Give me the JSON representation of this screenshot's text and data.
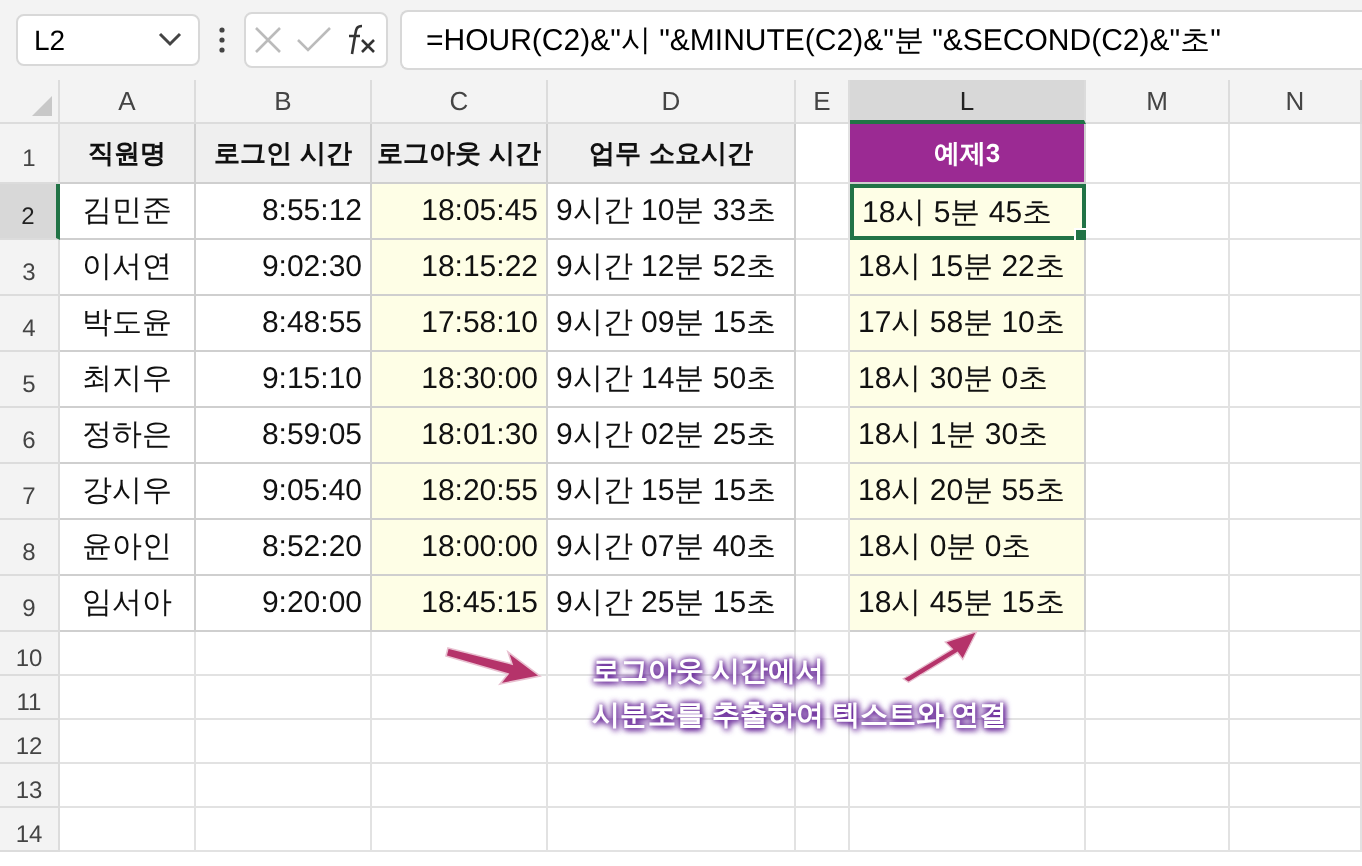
{
  "name_box": {
    "value": "L2"
  },
  "formula_bar": {
    "formula": "=HOUR(C2)&\"시 \"&MINUTE(C2)&\"분 \"&SECOND(C2)&\"초\""
  },
  "columns": [
    {
      "label": "A",
      "selected": false
    },
    {
      "label": "B",
      "selected": false
    },
    {
      "label": "C",
      "selected": false
    },
    {
      "label": "D",
      "selected": false
    },
    {
      "label": "E",
      "selected": false
    },
    {
      "label": "L",
      "selected": true
    },
    {
      "label": "M",
      "selected": false
    },
    {
      "label": "N",
      "selected": false
    }
  ],
  "rows": [
    {
      "number": "1",
      "selected": false,
      "kind": "header",
      "cells": {
        "A": "직원명",
        "B": "로그인 시간",
        "C": "로그아웃 시간",
        "D": "업무 소요시간",
        "L": "예제3"
      }
    },
    {
      "number": "2",
      "selected": true,
      "kind": "data",
      "cells": {
        "A": "김민준",
        "B": "8:55:12",
        "C": "18:05:45",
        "D": "9시간 10분 33초",
        "L": "18시 5분 45초"
      }
    },
    {
      "number": "3",
      "selected": false,
      "kind": "data",
      "cells": {
        "A": "이서연",
        "B": "9:02:30",
        "C": "18:15:22",
        "D": "9시간 12분 52초",
        "L": "18시 15분 22초"
      }
    },
    {
      "number": "4",
      "selected": false,
      "kind": "data",
      "cells": {
        "A": "박도윤",
        "B": "8:48:55",
        "C": "17:58:10",
        "D": "9시간 09분 15초",
        "L": "17시 58분 10초"
      }
    },
    {
      "number": "5",
      "selected": false,
      "kind": "data",
      "cells": {
        "A": "최지우",
        "B": "9:15:10",
        "C": "18:30:00",
        "D": "9시간 14분 50초",
        "L": "18시 30분 0초"
      }
    },
    {
      "number": "6",
      "selected": false,
      "kind": "data",
      "cells": {
        "A": "정하은",
        "B": "8:59:05",
        "C": "18:01:30",
        "D": "9시간 02분 25초",
        "L": "18시 1분 30초"
      }
    },
    {
      "number": "7",
      "selected": false,
      "kind": "data",
      "cells": {
        "A": "강시우",
        "B": "9:05:40",
        "C": "18:20:55",
        "D": "9시간 15분 15초",
        "L": "18시 20분 55초"
      }
    },
    {
      "number": "8",
      "selected": false,
      "kind": "data",
      "cells": {
        "A": "윤아인",
        "B": "8:52:20",
        "C": "18:00:00",
        "D": "9시간 07분 40초",
        "L": "18시 0분 0초"
      }
    },
    {
      "number": "9",
      "selected": false,
      "kind": "data",
      "cells": {
        "A": "임서아",
        "B": "9:20:00",
        "C": "18:45:15",
        "D": "9시간 25분 15초",
        "L": "18시 45분 15초"
      }
    },
    {
      "number": "10",
      "selected": false,
      "kind": "empty"
    },
    {
      "number": "11",
      "selected": false,
      "kind": "empty"
    },
    {
      "number": "12",
      "selected": false,
      "kind": "empty"
    },
    {
      "number": "13",
      "selected": false,
      "kind": "empty"
    },
    {
      "number": "14",
      "selected": false,
      "kind": "empty"
    }
  ],
  "annotation": {
    "lines": [
      "로그아웃 시간에서",
      "시분초를 추출하여 텍스트와 연결"
    ]
  }
}
